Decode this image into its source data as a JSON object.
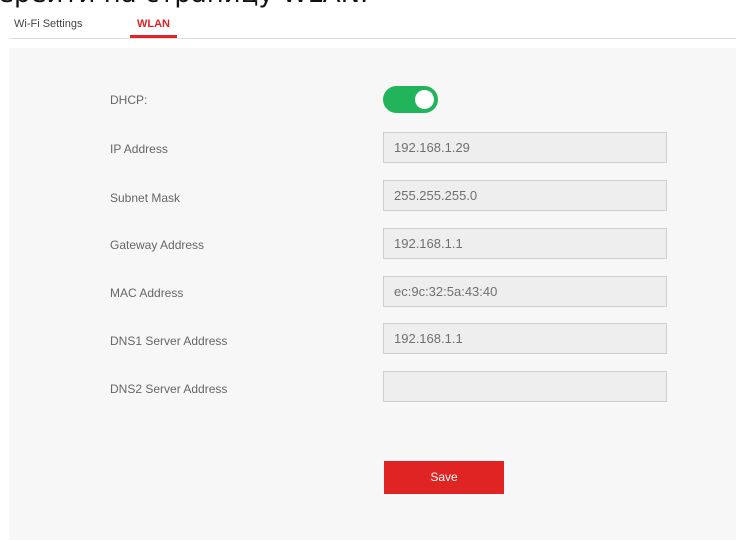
{
  "caption_fragment": "ерейти на страницу WLAN.",
  "tabs": [
    {
      "label": "Wi-Fi Settings",
      "active": false
    },
    {
      "label": "WLAN",
      "active": true
    }
  ],
  "accent_color": "#e02323",
  "toggle_color": "#21b45a",
  "form": {
    "dhcp": {
      "label": "DHCP:",
      "enabled": true
    },
    "fields": [
      {
        "label": "IP Address",
        "value": "192.168.1.29"
      },
      {
        "label": "Subnet Mask",
        "value": "255.255.255.0"
      },
      {
        "label": "Gateway Address",
        "value": "192.168.1.1"
      },
      {
        "label": "MAC Address",
        "value": "ec:9c:32:5a:43:40"
      },
      {
        "label": "DNS1 Server Address",
        "value": "192.168.1.1"
      },
      {
        "label": "DNS2 Server Address",
        "value": ""
      }
    ],
    "save_label": "Save"
  }
}
